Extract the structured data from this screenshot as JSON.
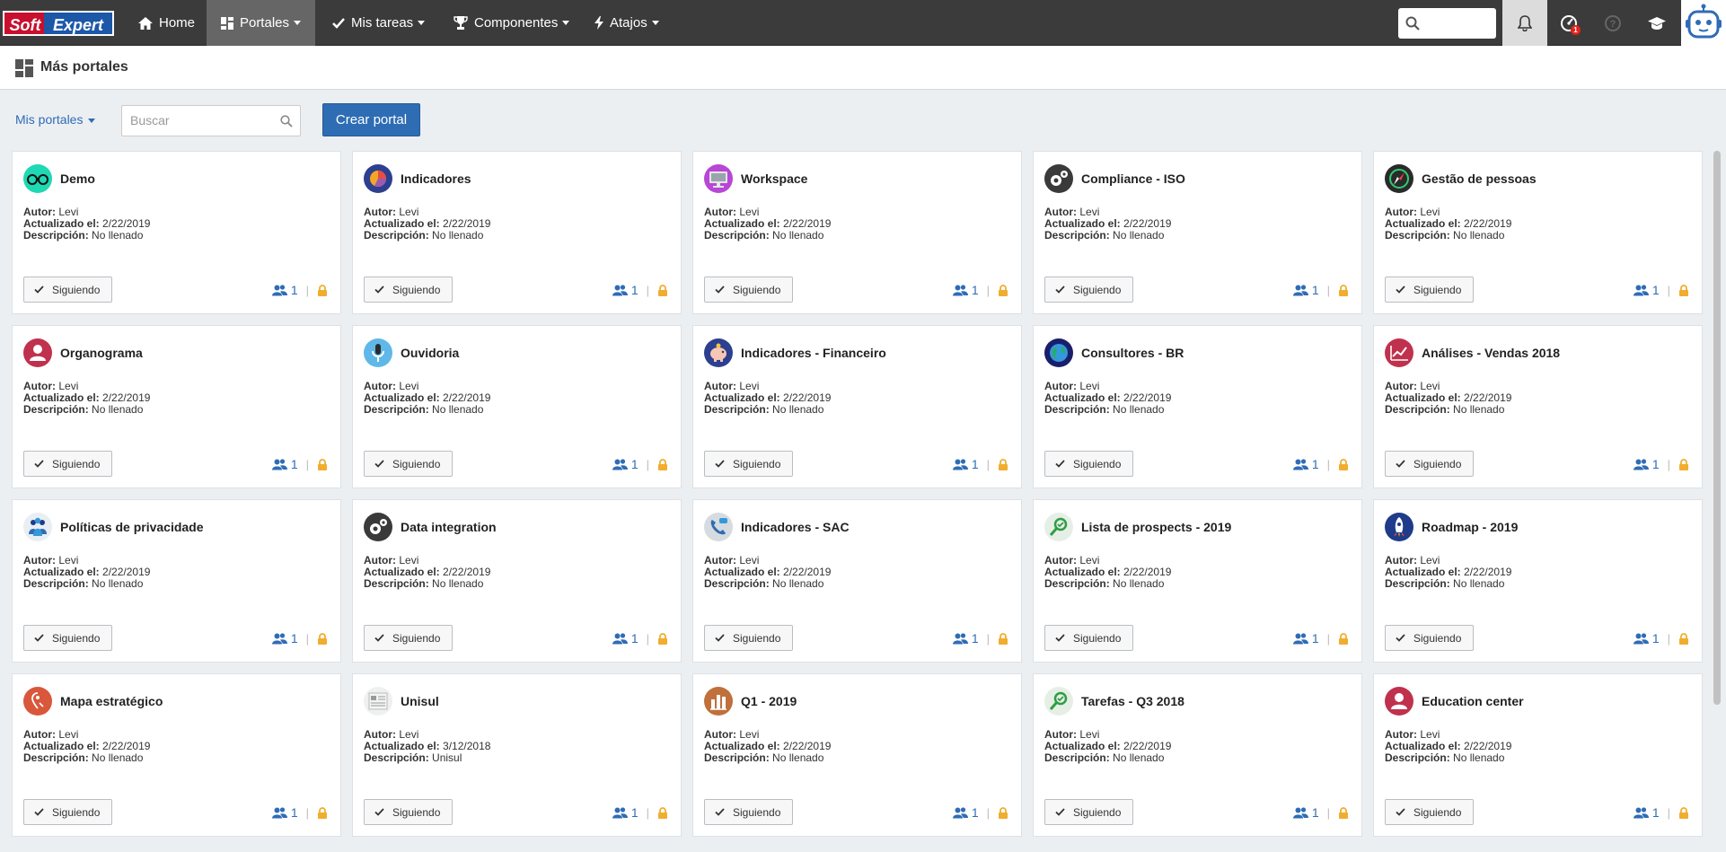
{
  "topbar": {
    "logo_soft": "Soft",
    "logo_expert": "Expert",
    "nav": [
      {
        "label": "Home",
        "icon": "home-icon"
      },
      {
        "label": "Portales",
        "icon": "portal-icon",
        "active": true
      },
      {
        "label": "Mis tareas",
        "icon": "check-icon"
      },
      {
        "label": "Componentes",
        "icon": "trophy-icon"
      },
      {
        "label": "Atajos",
        "icon": "bolt-icon"
      }
    ],
    "notification_badge": "1"
  },
  "page": {
    "title": "Más portales"
  },
  "toolbar": {
    "filter_label": "Mis portales",
    "search_placeholder": "Buscar",
    "create_label": "Crear portal"
  },
  "labels": {
    "author": "Autor:",
    "updated": "Actualizado el:",
    "description": "Descripción:",
    "follow": "Siguiendo"
  },
  "portals": [
    {
      "title": "Demo",
      "author": "Levi",
      "updated": "2/22/2019",
      "description": "No llenado",
      "followers": "1",
      "icon": "glasses-icon",
      "color": "#1fd8b4"
    },
    {
      "title": "Indicadores",
      "author": "Levi",
      "updated": "2/22/2019",
      "description": "No llenado",
      "followers": "1",
      "icon": "pie-chart-icon",
      "color": "#2d3f8f"
    },
    {
      "title": "Workspace",
      "author": "Levi",
      "updated": "2/22/2019",
      "description": "No llenado",
      "followers": "1",
      "icon": "monitor-icon",
      "color": "#b846d6"
    },
    {
      "title": "Compliance - ISO",
      "author": "Levi",
      "updated": "2/22/2019",
      "description": "No llenado",
      "followers": "1",
      "icon": "gears-icon",
      "color": "#3a3a3a"
    },
    {
      "title": "Gestão de pessoas",
      "author": "Levi",
      "updated": "2/22/2019",
      "description": "No llenado",
      "followers": "1",
      "icon": "compass-icon",
      "color": "#2a2a2a"
    },
    {
      "title": "Organograma",
      "author": "Levi",
      "updated": "2/22/2019",
      "description": "No llenado",
      "followers": "1",
      "icon": "user-icon",
      "color": "#c0314d"
    },
    {
      "title": "Ouvidoria",
      "author": "Levi",
      "updated": "2/22/2019",
      "description": "No llenado",
      "followers": "1",
      "icon": "microphone-icon",
      "color": "#5fb8e8"
    },
    {
      "title": "Indicadores - Financeiro",
      "author": "Levi",
      "updated": "2/22/2019",
      "description": "No llenado",
      "followers": "1",
      "icon": "piggy-bank-icon",
      "color": "#2d3f8f"
    },
    {
      "title": "Consultores - BR",
      "author": "Levi",
      "updated": "2/22/2019",
      "description": "No llenado",
      "followers": "1",
      "icon": "globe-icon",
      "color": "#1a1f6b"
    },
    {
      "title": "Análises - Vendas 2018",
      "author": "Levi",
      "updated": "2/22/2019",
      "description": "No llenado",
      "followers": "1",
      "icon": "line-chart-icon",
      "color": "#c0314d"
    },
    {
      "title": "Políticas de privacidade",
      "author": "Levi",
      "updated": "2/22/2019",
      "description": "No llenado",
      "followers": "1",
      "icon": "people-icon",
      "color": "#e8eef2"
    },
    {
      "title": "Data integration",
      "author": "Levi",
      "updated": "2/22/2019",
      "description": "No llenado",
      "followers": "1",
      "icon": "gears-icon",
      "color": "#3a3a3a"
    },
    {
      "title": "Indicadores - SAC",
      "author": "Levi",
      "updated": "2/22/2019",
      "description": "No llenado",
      "followers": "1",
      "icon": "phone-chat-icon",
      "color": "#d6dbe0"
    },
    {
      "title": "Lista de prospects - 2019",
      "author": "Levi",
      "updated": "2/22/2019",
      "description": "No llenado",
      "followers": "1",
      "icon": "magnifier-icon",
      "color": "#e6efe6"
    },
    {
      "title": "Roadmap - 2019",
      "author": "Levi",
      "updated": "2/22/2019",
      "description": "No llenado",
      "followers": "1",
      "icon": "rocket-icon",
      "color": "#1f3b8a"
    },
    {
      "title": "Mapa estratégico",
      "author": "Levi",
      "updated": "2/22/2019",
      "description": "No llenado",
      "followers": "1",
      "icon": "map-icon",
      "color": "#d9573b"
    },
    {
      "title": "Unisul",
      "author": "Levi",
      "updated": "3/12/2018",
      "description": "Unisul",
      "followers": "1",
      "icon": "document-icon",
      "color": "#eef0f2"
    },
    {
      "title": "Q1 - 2019",
      "author": "Levi",
      "updated": "2/22/2019",
      "description": "No llenado",
      "followers": "1",
      "icon": "bar-chart-icon",
      "color": "#c0703a"
    },
    {
      "title": "Tarefas - Q3 2018",
      "author": "Levi",
      "updated": "2/22/2019",
      "description": "No llenado",
      "followers": "1",
      "icon": "magnifier-icon",
      "color": "#e6efe6"
    },
    {
      "title": "Education center",
      "author": "Levi",
      "updated": "2/22/2019",
      "description": "No llenado",
      "followers": "1",
      "icon": "user-icon",
      "color": "#c0314d"
    }
  ]
}
